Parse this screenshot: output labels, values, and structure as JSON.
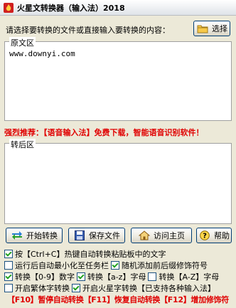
{
  "window": {
    "title": "火星文转换器（输入法）2018"
  },
  "prompt": "请选择要转换的文件或直接输入要转换的内容：",
  "select_button": "选择",
  "source": {
    "legend": "原文区",
    "text": "www.downyi.com"
  },
  "promo": "强烈推荐：【语音输入法】免费下载，智能语音识别软件！",
  "target": {
    "legend": "转后区",
    "text": ""
  },
  "buttons": {
    "convert": "开始转换",
    "save": "保存文件",
    "home": "访问主页",
    "help": "帮助"
  },
  "options": {
    "row1": {
      "label": "按【Ctrl+C】热键自动转换粘贴板中的文字",
      "checked": true
    },
    "row2a": {
      "label": "运行后自动最小化至任务栏",
      "checked": false
    },
    "row2b": {
      "label": "随机添加前后缀修饰符号",
      "checked": true
    },
    "row3a": {
      "label": "转换【0-9】数字",
      "checked": true
    },
    "row3b": {
      "label": "转换【a-z】字母",
      "checked": true
    },
    "row3c": {
      "label": "转换【A-Z】字母",
      "checked": false
    },
    "row4a": {
      "label": "开启繁体字转换",
      "checked": false
    },
    "row4b": {
      "label": "开启火星字转换【已支持各种输入法】",
      "checked": true
    }
  },
  "hotkeys": "【F10】暂停自动转换【F11】恢复自动转换【F12】增加修饰符",
  "colors": {
    "accent_red": "#e00000",
    "check_green": "#21a121",
    "button_border": "#003c74"
  },
  "icons": {
    "app": "flame-icon",
    "select": "folder-icon",
    "convert": "double-arrow-icon",
    "save": "floppy-icon",
    "home": "house-icon",
    "help": "question-icon"
  }
}
